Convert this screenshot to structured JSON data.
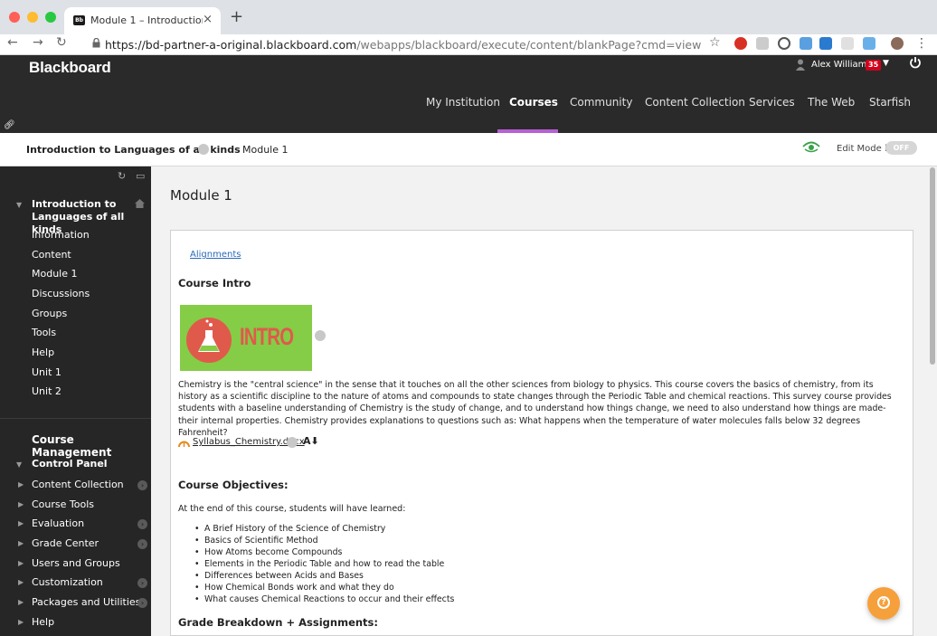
{
  "browser": {
    "tab_title": "Module 1 – Introduction to Lang",
    "tab_favicon": "Bb",
    "url_host": "https://bd-partner-a-original.blackboard.com",
    "url_path": "/webapps/blackboard/execute/content/blankPage?cmd=view&content_id=_1786_1&cours..."
  },
  "header": {
    "logo": "Blackboard",
    "user_name": "Alex Williams",
    "notification_count": "35",
    "nav": [
      "My Institution",
      "Courses",
      "Community",
      "Content Collection",
      "Services",
      "The Web",
      "Starfish"
    ],
    "active_nav": "Courses",
    "accent_color": "#b760d4"
  },
  "breadcrumb": {
    "course": "Introduction to Languages of all kinds",
    "current": "Module 1",
    "edit_mode_label": "Edit Mode is:",
    "edit_mode_value": "OFF"
  },
  "sidebar": {
    "course_title": "Introduction to Languages of all kinds",
    "items": [
      "Information",
      "Content",
      "Module 1",
      "Discussions",
      "Groups",
      "Tools",
      "Help",
      "Unit 1",
      "Unit 2"
    ],
    "management_heading": "Course Management",
    "control_panel_heading": "Control Panel",
    "control_panel_items": [
      "Content Collection",
      "Course Tools",
      "Evaluation",
      "Grade Center",
      "Users and Groups",
      "Customization",
      "Packages and Utilities",
      "Help"
    ]
  },
  "main": {
    "page_title": "Module 1",
    "alignments_link": "Alignments",
    "course_intro_heading": "Course Intro",
    "intro_image_text": "INTRO",
    "description": "Chemistry is the \"central science\" in the sense that it touches on all the other sciences from biology to physics. This course covers the basics of chemistry, from its history as a scientific discipline to the nature of atoms and compounds to state changes through the Periodic Table and chemical reactions. This survey course provides students with a baseline understanding of  Chemistry is the study of change, and to understand how things change, we need to also understand how things are made- their internal properties. Chemistry provides explanations to questions such as: What happens when the temperature of water molecules falls below 32 degrees Fahrenheit?",
    "attachment": "Syllabus_Chemistry.docx",
    "objectives_heading": "Course Objectives:",
    "objectives_intro": "At the end of this course, students will have learned:",
    "objectives": [
      "A Brief History of the Science of Chemistry",
      "Basics of Scientific Method",
      "How Atoms become Compounds",
      "Elements in the Periodic Table and how to read the table",
      "Differences between Acids and Bases",
      "How Chemical Bonds work and what they do",
      "What causes Chemical Reactions to occur and their effects"
    ],
    "grade_heading": "Grade Breakdown + Assignments:"
  },
  "icons": [
    "lock-icon",
    "star-icon",
    "user-icon",
    "power-icon",
    "eye-icon",
    "home-icon",
    "refresh-icon",
    "folder-icon",
    "attachment-icon",
    "help-icon"
  ]
}
